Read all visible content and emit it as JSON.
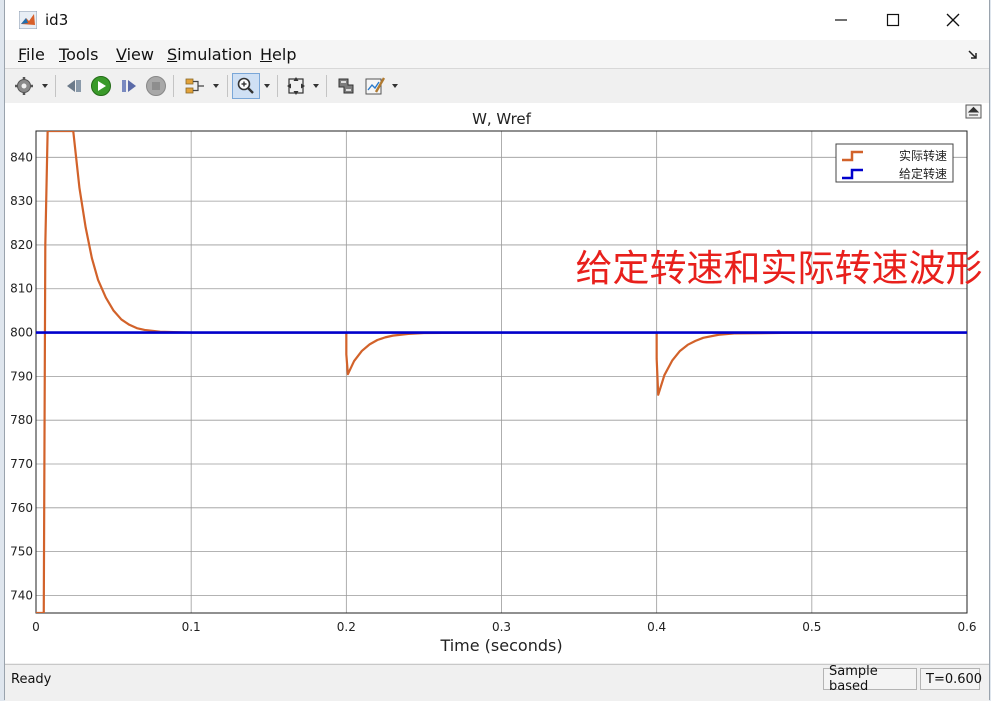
{
  "window": {
    "title": "id3",
    "colors": {
      "titlebar": "#ffffff",
      "plot_background": "#ffffff"
    }
  },
  "menu": [
    {
      "label": "File",
      "mnemonic": "F",
      "rest": "ile"
    },
    {
      "label": "Tools",
      "mnemonic": "T",
      "rest": "ools"
    },
    {
      "label": "View",
      "mnemonic": "V",
      "rest": "iew"
    },
    {
      "label": "Simulation",
      "mnemonic": "S",
      "rest": "imulation"
    },
    {
      "label": "Help",
      "mnemonic": "H",
      "rest": "elp"
    }
  ],
  "toolbar": {
    "icons": [
      "configuration-icon",
      "step-back-icon",
      "run-icon",
      "step-forward-icon",
      "stop-icon",
      "signal-selector-icon",
      "zoom-icon",
      "autoscale-icon",
      "highlight-block-icon",
      "style-icon"
    ]
  },
  "annotation": "给定转速和实际转速波形",
  "status": {
    "ready": "Ready",
    "sample": "Sample based",
    "time": "T=0.600"
  },
  "chart_data": {
    "type": "line",
    "title": "W, Wref",
    "xlabel": "Time (seconds)",
    "ylabel": "",
    "xlim": [
      0,
      0.6
    ],
    "ylim": [
      736,
      846
    ],
    "xticks": [
      0,
      0.1,
      0.2,
      0.3,
      0.4,
      0.5,
      0.6
    ],
    "xtick_labels": [
      "0",
      "0.1",
      "0.2",
      "0.3",
      "0.4",
      "0.5",
      "0.6"
    ],
    "yticks": [
      740,
      750,
      760,
      770,
      780,
      790,
      800,
      810,
      820,
      830,
      840
    ],
    "ytick_labels": [
      "740",
      "750",
      "760",
      "770",
      "780",
      "790",
      "800",
      "810",
      "820",
      "830",
      "840"
    ],
    "grid": true,
    "legend_position": "top-right",
    "series": [
      {
        "name": "实际转速",
        "color": "#d2622a",
        "x": [
          0.0,
          0.005,
          0.006,
          0.0075,
          0.024,
          0.028,
          0.032,
          0.036,
          0.04,
          0.045,
          0.05,
          0.055,
          0.06,
          0.065,
          0.07,
          0.08,
          0.1,
          0.19999,
          0.2,
          0.201,
          0.205,
          0.21,
          0.215,
          0.22,
          0.225,
          0.23,
          0.24,
          0.25,
          0.3,
          0.39999,
          0.4,
          0.401,
          0.405,
          0.41,
          0.415,
          0.42,
          0.425,
          0.43,
          0.44,
          0.45,
          0.5,
          0.6
        ],
        "y": [
          736,
          736,
          820,
          846,
          846,
          833,
          824,
          817,
          812,
          808,
          805,
          803,
          801.8,
          801,
          800.6,
          800.2,
          800,
          800,
          795,
          790.5,
          793.5,
          795.8,
          797.3,
          798.3,
          798.9,
          799.3,
          799.7,
          799.9,
          800,
          800,
          794,
          785.8,
          790.3,
          793.6,
          795.8,
          797.2,
          798.1,
          798.8,
          799.5,
          799.8,
          800,
          800
        ]
      },
      {
        "name": "给定转速",
        "color": "#0000cc",
        "x": [
          0,
          0.6
        ],
        "y": [
          800,
          800
        ]
      }
    ]
  }
}
